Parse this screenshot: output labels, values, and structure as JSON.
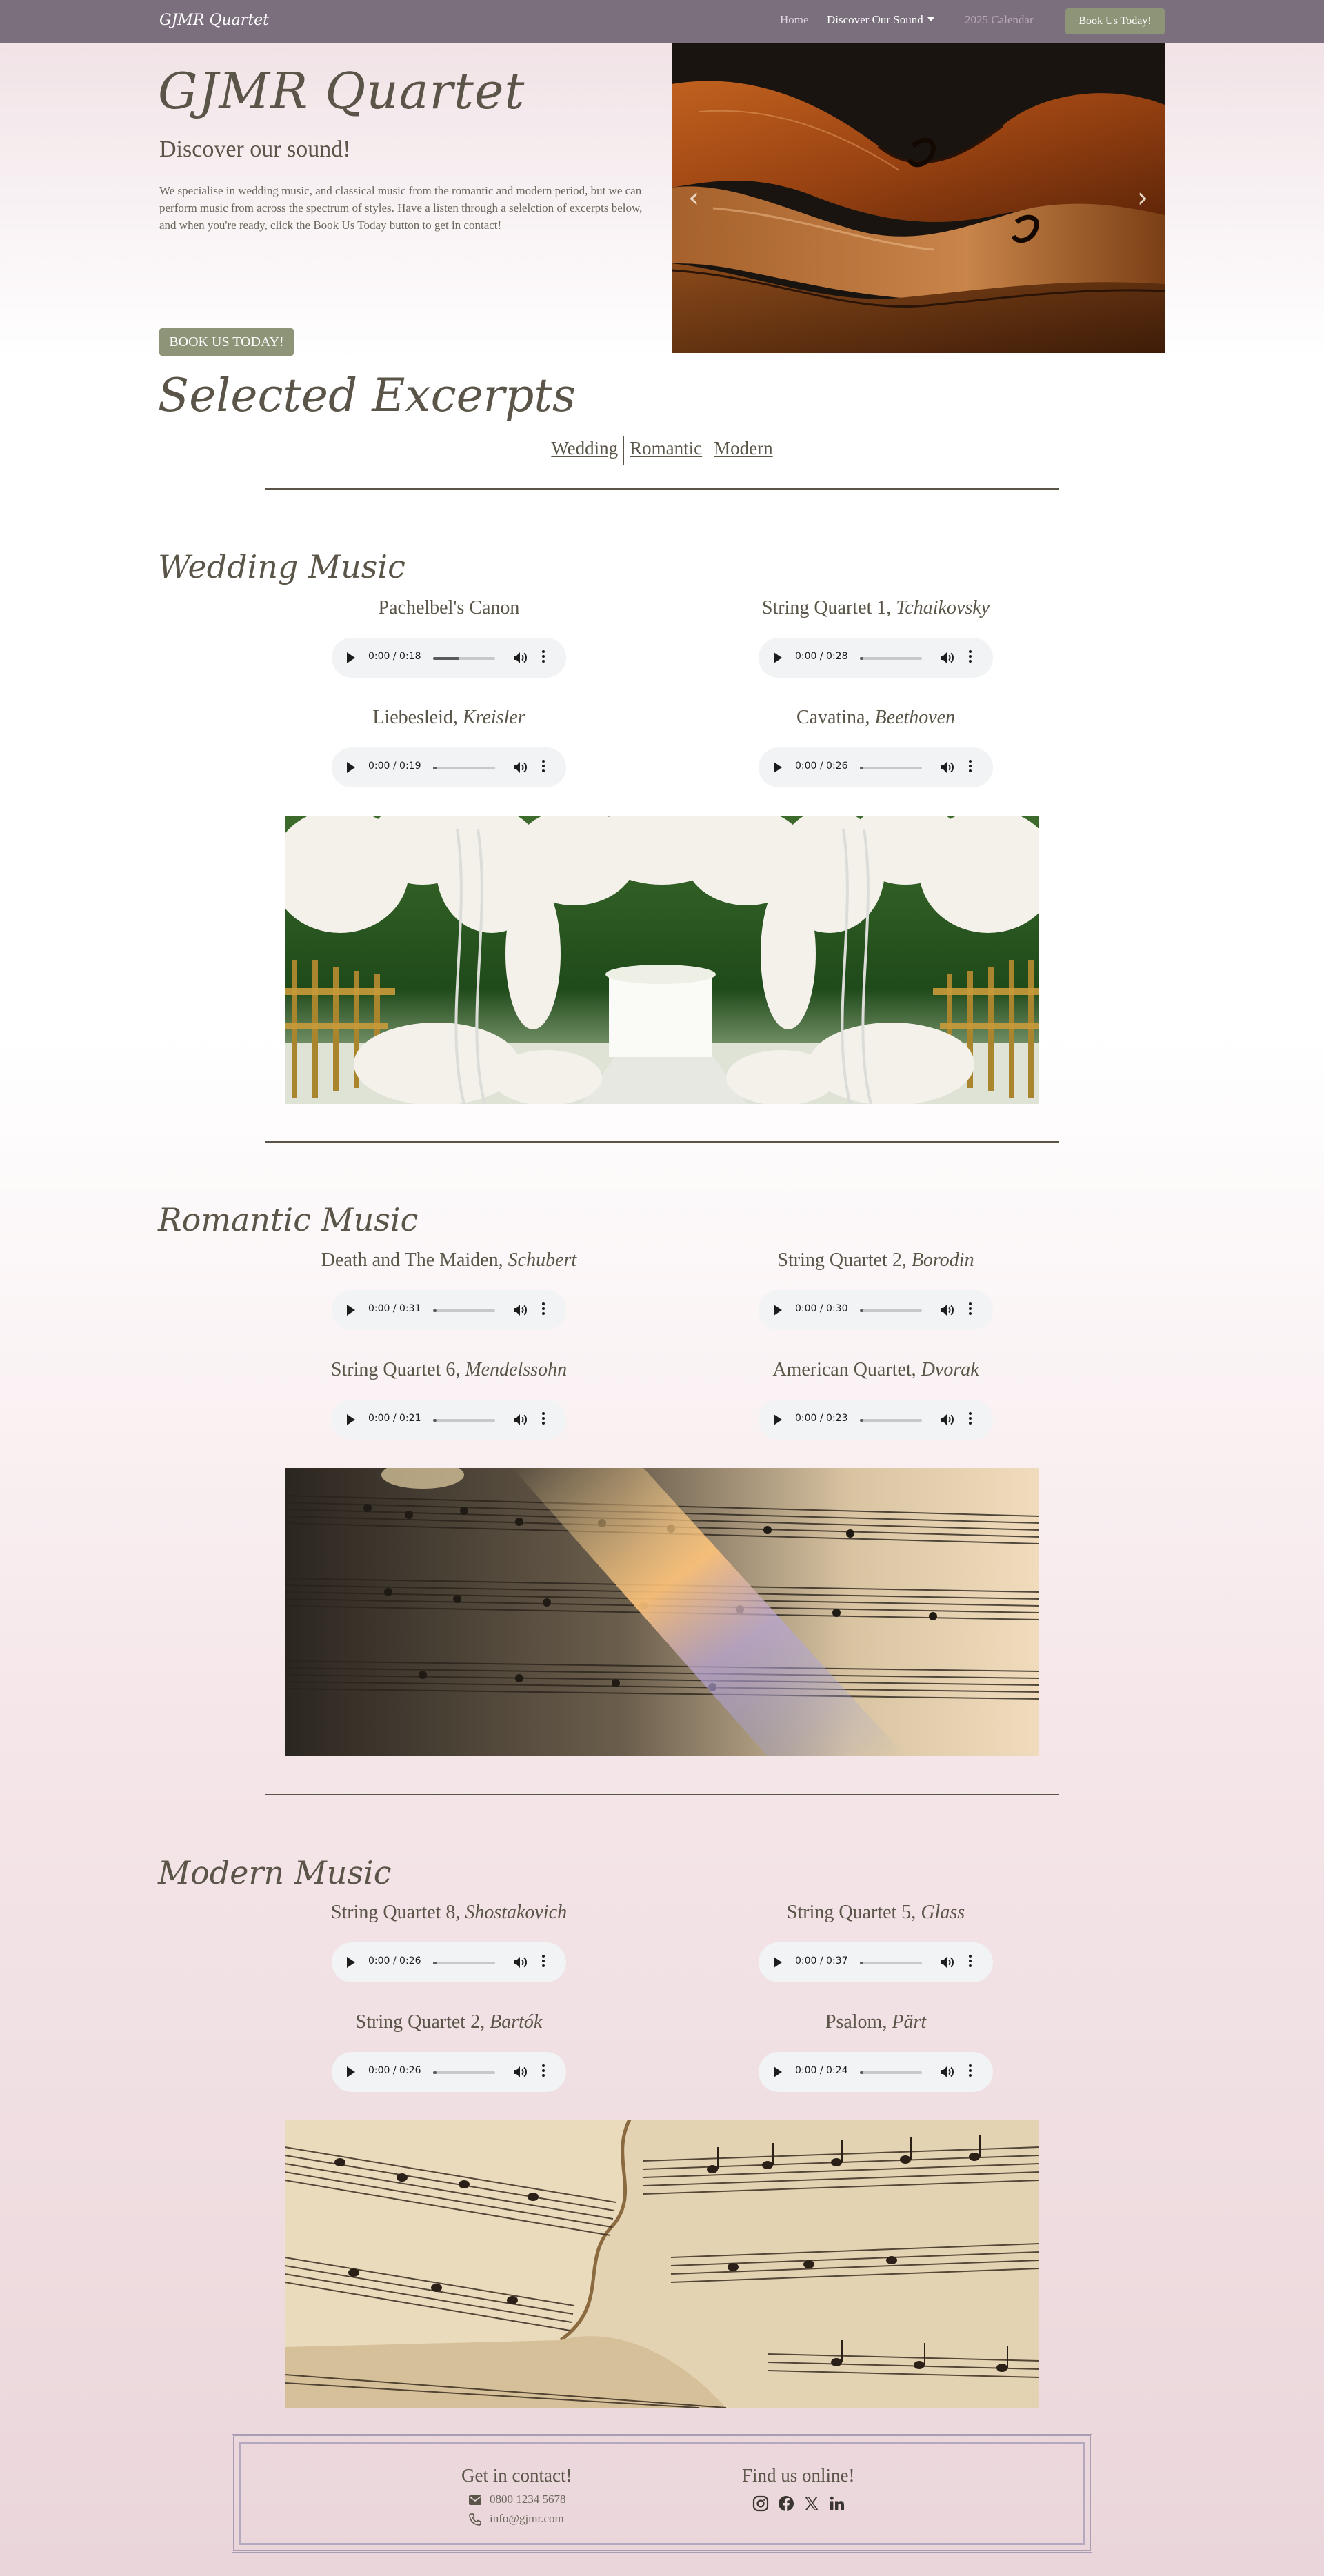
{
  "nav": {
    "brand": "GJMR Quartet",
    "links": [
      "Home",
      "Discover Our Sound",
      "2025 Calendar"
    ],
    "cta": "Book Us Today!"
  },
  "hero": {
    "title": "GJMR Quartet",
    "subtitle": "Discover our sound!",
    "description": "We specialise in wedding music, and classical music from the romantic and modern period, but we can perform music from across the spectrum of styles. Have a listen through a selelction of excerpts below, and when you're ready, click the Book Us Today button to get in contact!",
    "button": "BOOK US TODAY!",
    "carousel_prev": "‹",
    "carousel_next": "›"
  },
  "excerpts": {
    "title": "Selected Excerpts",
    "links": [
      "Wedding",
      "Romantic",
      "Modern"
    ]
  },
  "sections": [
    {
      "title": "Wedding Music",
      "tracks": [
        {
          "name": "Pachelbel's Canon",
          "composer": "",
          "time": "0:00 / 0:18",
          "progress": 0.42
        },
        {
          "name": "String Quartet 1, ",
          "composer": "Tchaikovsky",
          "time": "0:00 / 0:28",
          "progress": 0.05
        },
        {
          "name": "Liebesleid, ",
          "composer": "Kreisler",
          "time": "0:00 / 0:19",
          "progress": 0.05
        },
        {
          "name": "Cavatina, ",
          "composer": "Beethoven",
          "time": "0:00 / 0:26",
          "progress": 0.05
        }
      ]
    },
    {
      "title": "Romantic Music",
      "tracks": [
        {
          "name": "Death and The Maiden, ",
          "composer": "Schubert",
          "time": "0:00 / 0:31",
          "progress": 0.05
        },
        {
          "name": "String Quartet 2, ",
          "composer": "Borodin",
          "time": "0:00 / 0:30",
          "progress": 0.05
        },
        {
          "name": "String Quartet 6, ",
          "composer": "Mendelssohn",
          "time": "0:00 / 0:21",
          "progress": 0.05
        },
        {
          "name": "American Quartet, ",
          "composer": "Dvorak",
          "time": "0:00 / 0:23",
          "progress": 0.05
        }
      ]
    },
    {
      "title": "Modern Music",
      "tracks": [
        {
          "name": "String Quartet 8, ",
          "composer": "Shostakovich",
          "time": "0:00 / 0:26",
          "progress": 0.05
        },
        {
          "name": "String Quartet 5, ",
          "composer": "Glass",
          "time": "0:00 / 0:37",
          "progress": 0.05
        },
        {
          "name": "String Quartet 2, ",
          "composer": "Bartók",
          "time": "0:00 / 0:26",
          "progress": 0.05
        },
        {
          "name": "Psalom, ",
          "composer": "Pärt",
          "time": "0:00 / 0:24",
          "progress": 0.05
        }
      ]
    }
  ],
  "footer": {
    "contact_heading": "Get in contact!",
    "phone": "0800 1234 5678",
    "email": "info@gjmr.com",
    "social_heading": "Find us online!",
    "social_icons": [
      "instagram-icon",
      "facebook-icon",
      "x-icon",
      "linkedin-icon"
    ]
  },
  "colors": {
    "navbar": "#7b6f7d",
    "accent_button": "#8d9478",
    "text": "#5a5548"
  }
}
